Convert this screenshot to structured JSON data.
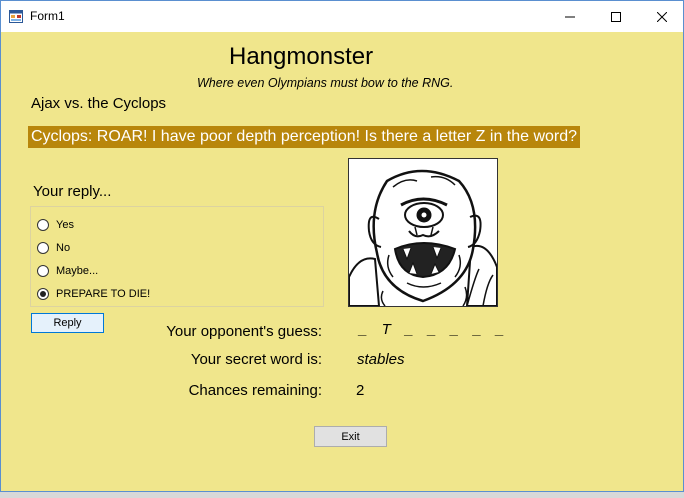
{
  "window": {
    "title": "Form1",
    "icons": {
      "app": "form-icon",
      "minimize": "minimize-icon",
      "maximize": "maximize-icon",
      "close": "close-icon"
    }
  },
  "game": {
    "title": "Hangmonster",
    "subtitle": "Where even Olympians must bow to the RNG.",
    "matchup": "Ajax vs. the Cyclops",
    "message": "Cyclops: ROAR! I have poor depth perception! Is there a letter Z in the word?",
    "portrait": "cyclops-portrait"
  },
  "reply": {
    "label": "Your reply...",
    "options": [
      {
        "label": "Yes",
        "checked": false
      },
      {
        "label": "No",
        "checked": false
      },
      {
        "label": "Maybe...",
        "checked": false
      },
      {
        "label": "PREPARE TO DIE!",
        "checked": true
      }
    ],
    "button_label": "Reply"
  },
  "status": {
    "guess_label": "Your opponent's guess:",
    "guess_value": "_  T  _  _  _  _  _",
    "word_label": "Your secret word is:",
    "word_value": "stables",
    "chances_label": "Chances remaining:",
    "chances_value": "2"
  },
  "exit_label": "Exit",
  "colors": {
    "background": "#f0e68c",
    "message_bg": "#b8860b",
    "message_text": "#ffffff"
  }
}
